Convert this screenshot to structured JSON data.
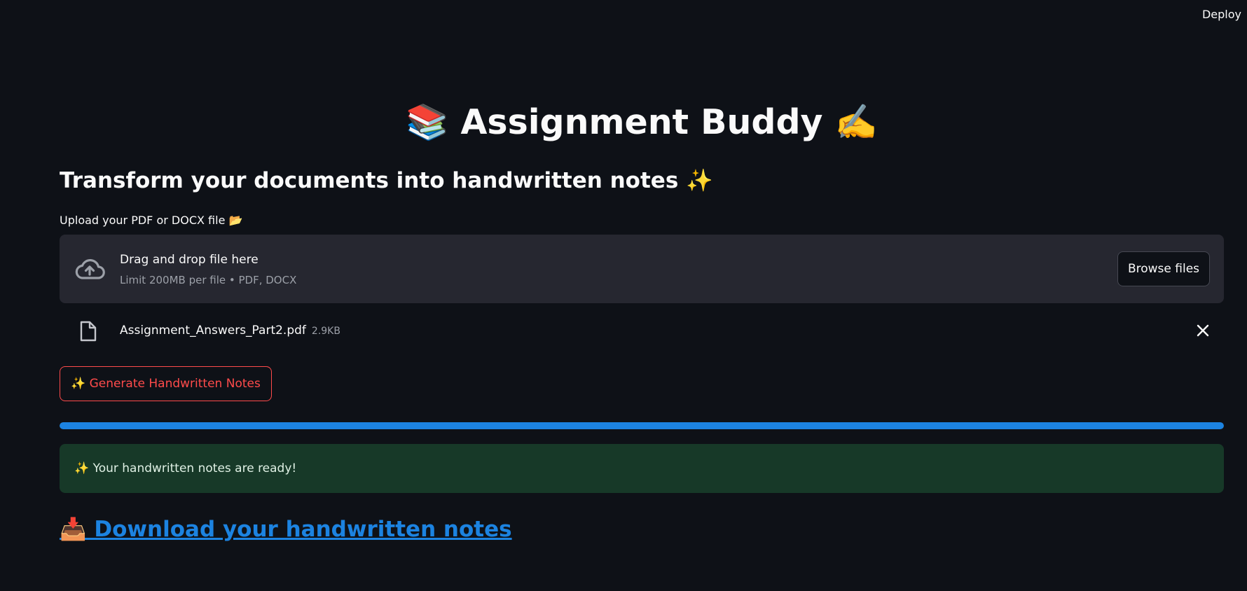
{
  "header": {
    "deploy_label": "Deploy"
  },
  "main": {
    "title": "📚 Assignment Buddy ✍️",
    "subtitle": "Transform your documents into handwritten notes ✨",
    "upload": {
      "label": "Upload your PDF or DOCX file 📂",
      "dropzone_text": "Drag and drop file here",
      "dropzone_limit": "Limit 200MB per file • PDF, DOCX",
      "browse_label": "Browse files",
      "icon": "cloud-upload-icon"
    },
    "file": {
      "name": "Assignment_Answers_Part2.pdf",
      "size": "2.9KB",
      "icon": "file-icon",
      "remove_icon": "close-icon"
    },
    "generate_label": "✨ Generate Handwritten Notes",
    "progress_percent": 100,
    "success_message": "✨ Your handwritten notes are ready!",
    "download_label": "📥 Download your handwritten notes"
  },
  "colors": {
    "background": "#0e1117",
    "surface": "#262730",
    "primary": "#ff4b4b",
    "link": "#1c83e1",
    "progress": "#1c83e1",
    "success_bg": "#173928"
  }
}
